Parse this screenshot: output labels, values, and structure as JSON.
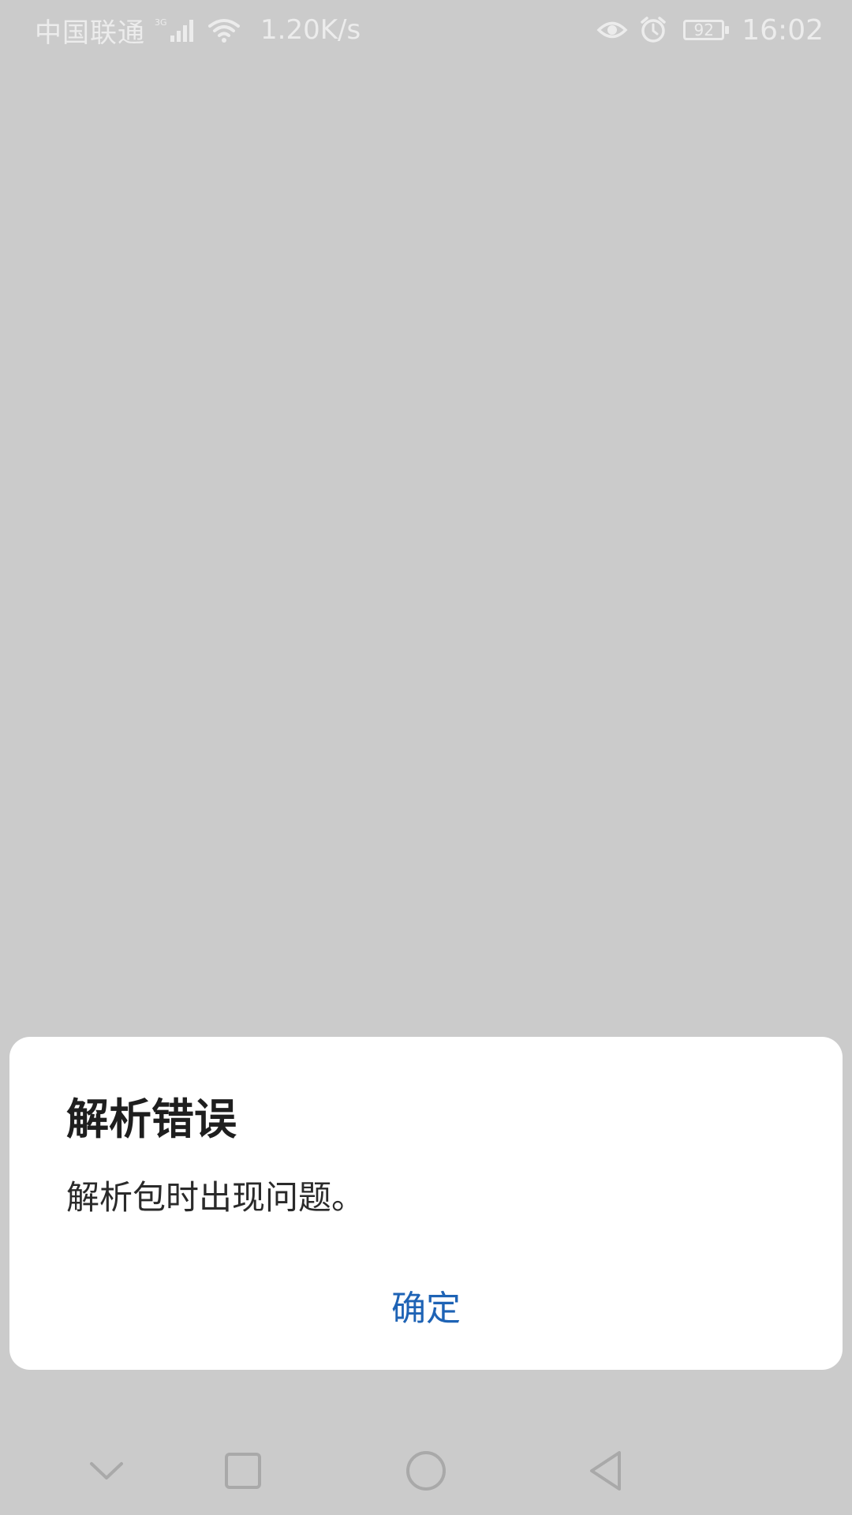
{
  "status_bar": {
    "carrier": "中国联通",
    "network_type": "3G",
    "net_speed": "1.20K/s",
    "battery_level": "92",
    "time": "16:02",
    "icons": [
      "signal-icon",
      "wifi-icon",
      "eye-icon",
      "alarm-icon",
      "battery-icon"
    ]
  },
  "dialog": {
    "title": "解析错误",
    "message": "解析包时出现问题。",
    "confirm_label": "确定"
  },
  "nav_bar": {
    "icons": [
      "nav-down-icon",
      "nav-recents-icon",
      "nav-home-icon",
      "nav-back-icon"
    ]
  },
  "colors": {
    "background": "#cbcbcb",
    "dialog_bg": "#ffffff",
    "accent": "#1e63b5",
    "status_text": "#ececec",
    "nav_icon": "#a9a9a9"
  }
}
